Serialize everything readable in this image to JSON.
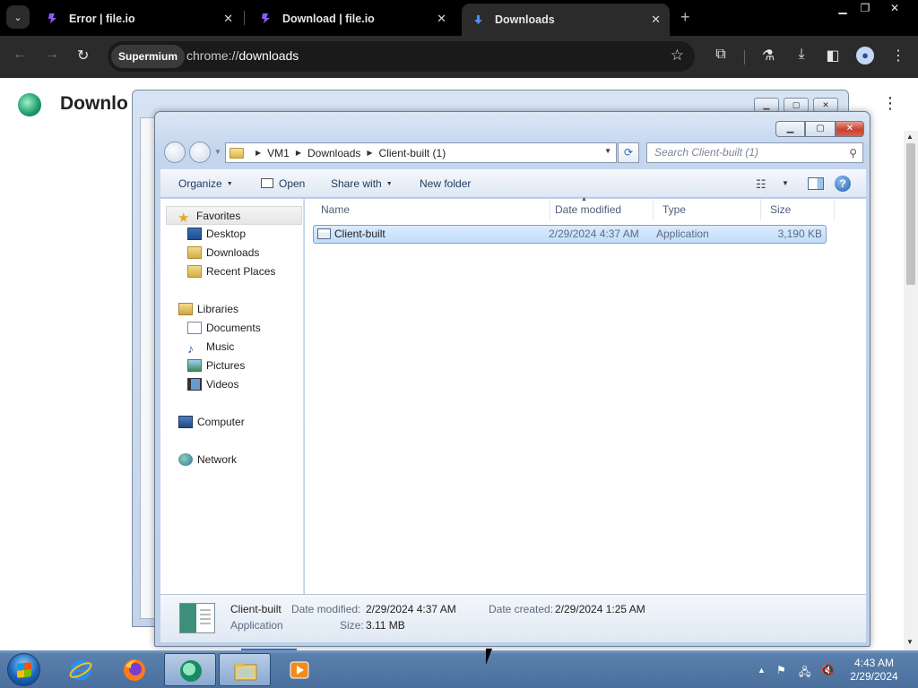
{
  "browser": {
    "tabs": [
      {
        "title": "Error | file.io",
        "active": false
      },
      {
        "title": "Download | file.io",
        "active": false
      },
      {
        "title": "Downloads",
        "active": true
      }
    ],
    "chip": "Supermium",
    "url_scheme": "chrome://",
    "url_host": "downloads"
  },
  "page": {
    "title": "Downlo"
  },
  "explorer": {
    "breadcrumb": [
      "VM1",
      "Downloads",
      "Client-built (1)"
    ],
    "search_placeholder": "Search Client-built (1)",
    "commands": {
      "organize": "Organize",
      "open": "Open",
      "share_with": "Share with",
      "new_folder": "New folder"
    },
    "nav": {
      "favorites": "Favorites",
      "desktop": "Desktop",
      "downloads": "Downloads",
      "recent_places": "Recent Places",
      "libraries": "Libraries",
      "documents": "Documents",
      "music": "Music",
      "pictures": "Pictures",
      "videos": "Videos",
      "computer": "Computer",
      "network": "Network"
    },
    "columns": {
      "name": "Name",
      "date_modified": "Date modified",
      "type": "Type",
      "size": "Size"
    },
    "files": [
      {
        "name": "Client-built",
        "date_modified": "2/29/2024 4:37 AM",
        "type": "Application",
        "size": "3,190 KB"
      }
    ],
    "details": {
      "name": "Client-built",
      "type": "Application",
      "date_modified_label": "Date modified:",
      "date_modified": "2/29/2024 4:37 AM",
      "size_label": "Size:",
      "size": "3.11 MB",
      "date_created_label": "Date created:",
      "date_created": "2/29/2024 1:25 AM"
    }
  },
  "taskbar": {
    "time": "4:43 AM",
    "date": "2/29/2024"
  },
  "colors": {
    "chrome_bg": "#000000",
    "toolbar_bg": "#2b2b2b",
    "selection": "#c1dcfc",
    "taskbar": "#4b6f9c"
  }
}
